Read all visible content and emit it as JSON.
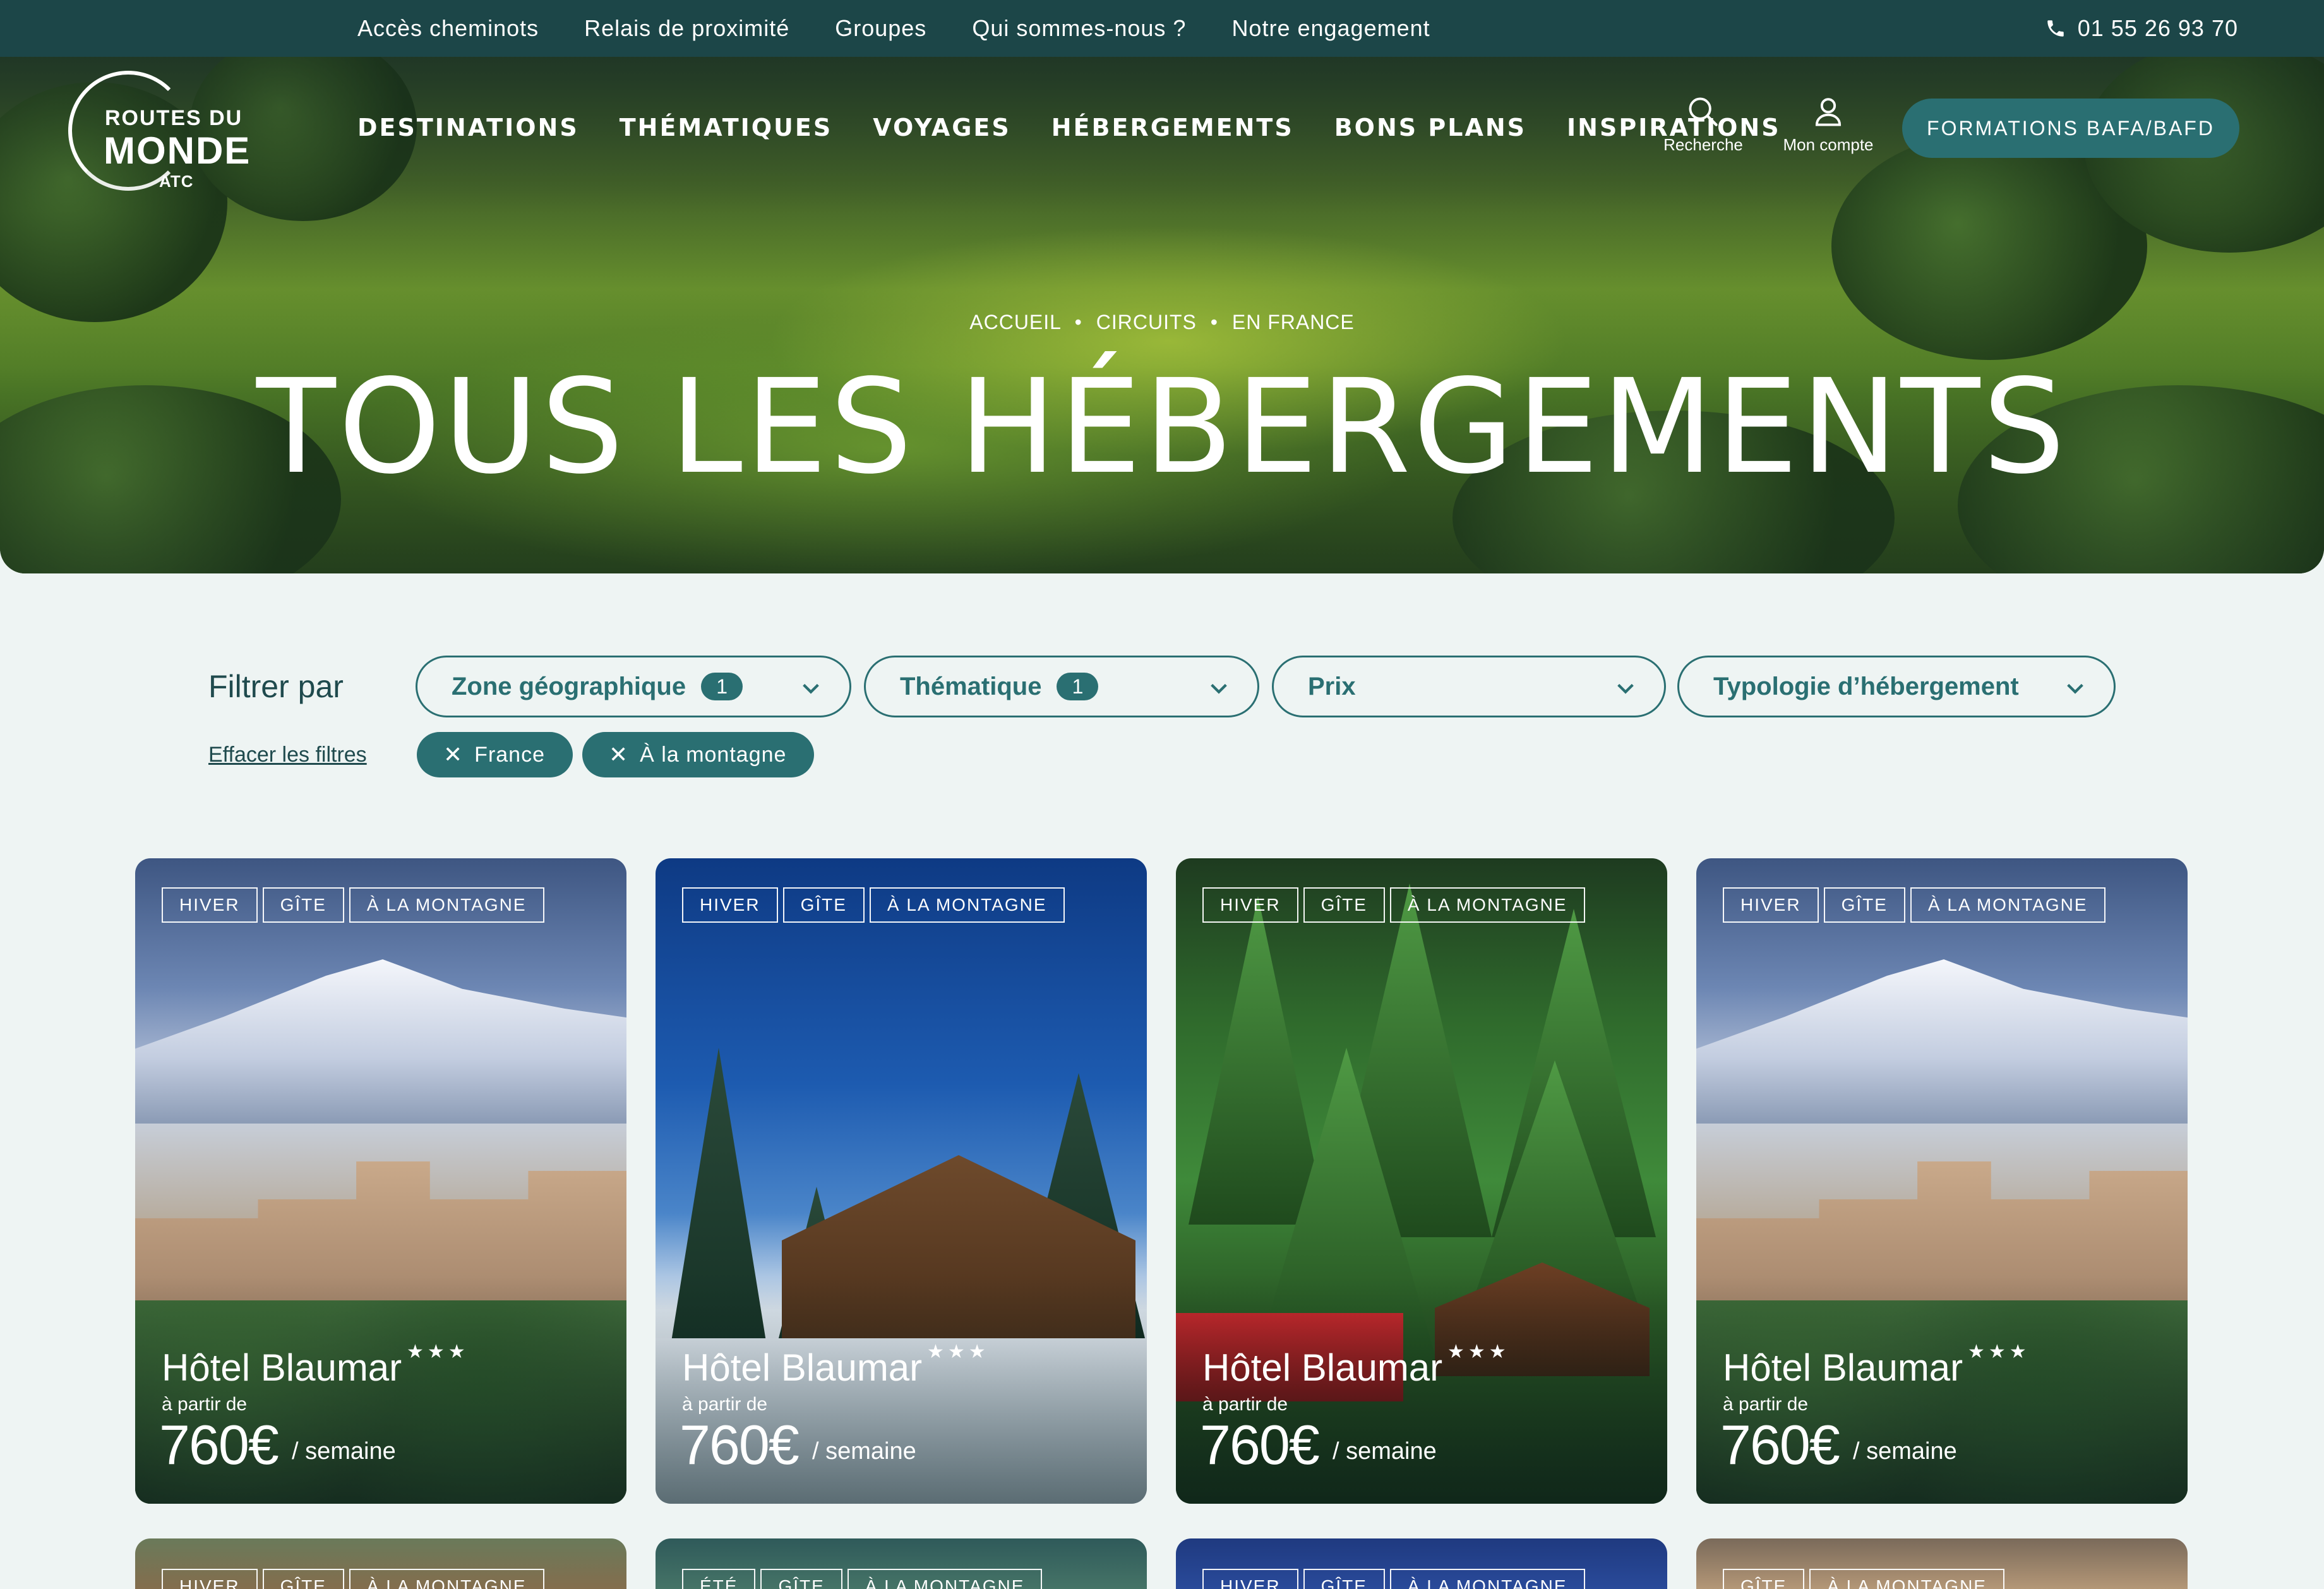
{
  "topbar": {
    "links": [
      "Accès cheminots",
      "Relais de proximité",
      "Groupes",
      "Qui sommes-nous ?",
      "Notre engagement"
    ],
    "phone": "01 55 26 93 70"
  },
  "logo": {
    "line1": "ROUTES DU",
    "line2": "MONDE",
    "line3": "ATC"
  },
  "nav": {
    "items": [
      "DESTINATIONS",
      "THÉMATIQUES",
      "VOYAGES",
      "HÉBERGEMENTS",
      "BONS PLANS",
      "INSPIRATIONS"
    ],
    "search_label": "Recherche",
    "account_label": "Mon compte",
    "cta_label": "FORMATIONS BAFA/BAFD"
  },
  "hero": {
    "breadcrumb": [
      "ACCUEIL",
      "CIRCUITS",
      "EN FRANCE"
    ],
    "breadcrumb_separator": "•",
    "title": "TOUS LES HÉBERGEMENTS"
  },
  "filters": {
    "label": "Filtrer par",
    "clear_label": "Effacer les filtres",
    "dropdowns": [
      {
        "label": "Zone géographique",
        "count": "1"
      },
      {
        "label": "Thématique",
        "count": "1"
      },
      {
        "label": "Prix",
        "count": ""
      },
      {
        "label": "Typologie d’hébergement",
        "count": ""
      }
    ],
    "chips": [
      "France",
      "À la montagne"
    ],
    "chip_remove_glyph": "✕"
  },
  "cards": [
    {
      "tags": [
        "HIVER",
        "GÎTE",
        "À LA MONTAGNE"
      ],
      "name": "Hôtel Blaumar",
      "stars": "★★★",
      "from": "à partir de",
      "price": "760€",
      "per": "/ semaine",
      "scene": "hotel"
    },
    {
      "tags": [
        "HIVER",
        "GÎTE",
        "À LA MONTAGNE"
      ],
      "name": "Hôtel Blaumar",
      "stars": "★★★",
      "from": "à partir de",
      "price": "760€",
      "per": "/ semaine",
      "scene": "chalet"
    },
    {
      "tags": [
        "HIVER",
        "GÎTE",
        "À LA MONTAGNE"
      ],
      "name": "Hôtel Blaumar",
      "stars": "★★★",
      "from": "à partir de",
      "price": "760€",
      "per": "/ semaine",
      "scene": "forest"
    },
    {
      "tags": [
        "HIVER",
        "GÎTE",
        "À LA MONTAGNE"
      ],
      "name": "Hôtel Blaumar",
      "stars": "★★★",
      "from": "à partir de",
      "price": "760€",
      "per": "/ semaine",
      "scene": "hotel"
    }
  ],
  "cards_row2": [
    {
      "tags": [
        "HIVER",
        "GÎTE",
        "À LA MONTAGNE"
      ]
    },
    {
      "tags": [
        "ÉTÉ",
        "GÎTE",
        "À LA MONTAGNE"
      ]
    },
    {
      "tags": [
        "HIVER",
        "GÎTE",
        "À LA MONTAGNE"
      ]
    },
    {
      "tags": [
        "GÎTE",
        "À LA MONTAGNE"
      ]
    }
  ],
  "colors": {
    "topbar_bg": "#1c4648",
    "accent": "#2a6f72",
    "page_bg": "#eef4f3",
    "text_dark": "#1f4a4d"
  }
}
